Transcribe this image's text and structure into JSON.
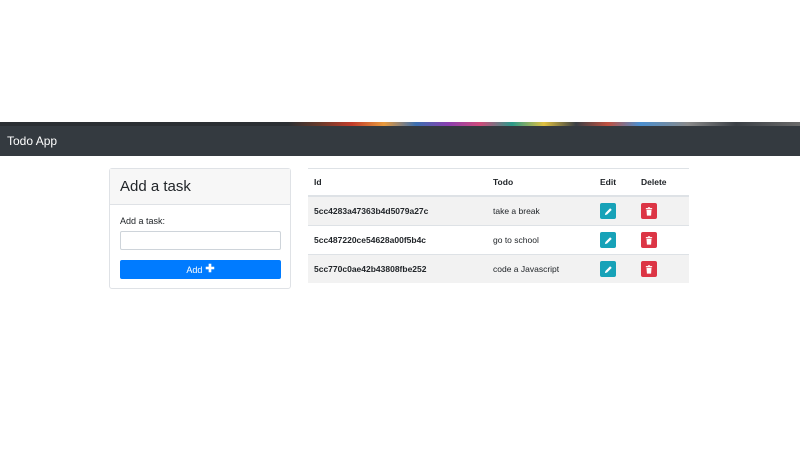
{
  "navbar": {
    "brand": "Todo App"
  },
  "add_card": {
    "title": "Add a task",
    "label": "Add a task:",
    "input_value": "",
    "button_label": "Add",
    "button_icon": "plus-icon"
  },
  "table": {
    "headers": {
      "id": "Id",
      "todo": "Todo",
      "edit": "Edit",
      "delete": "Delete"
    },
    "rows": [
      {
        "id": "5cc4283a47363b4d5079a27c",
        "todo": "take a break"
      },
      {
        "id": "5cc487220ce54628a00f5b4c",
        "todo": "go to school"
      },
      {
        "id": "5cc770c0ae42b43808fbe252",
        "todo": "code a Javascript"
      }
    ]
  },
  "colors": {
    "navbar": "#343a40",
    "primary": "#007bff",
    "edit": "#17a2b8",
    "delete": "#dc3545"
  },
  "icons": {
    "edit": "pencil-icon",
    "delete": "trash-icon"
  }
}
